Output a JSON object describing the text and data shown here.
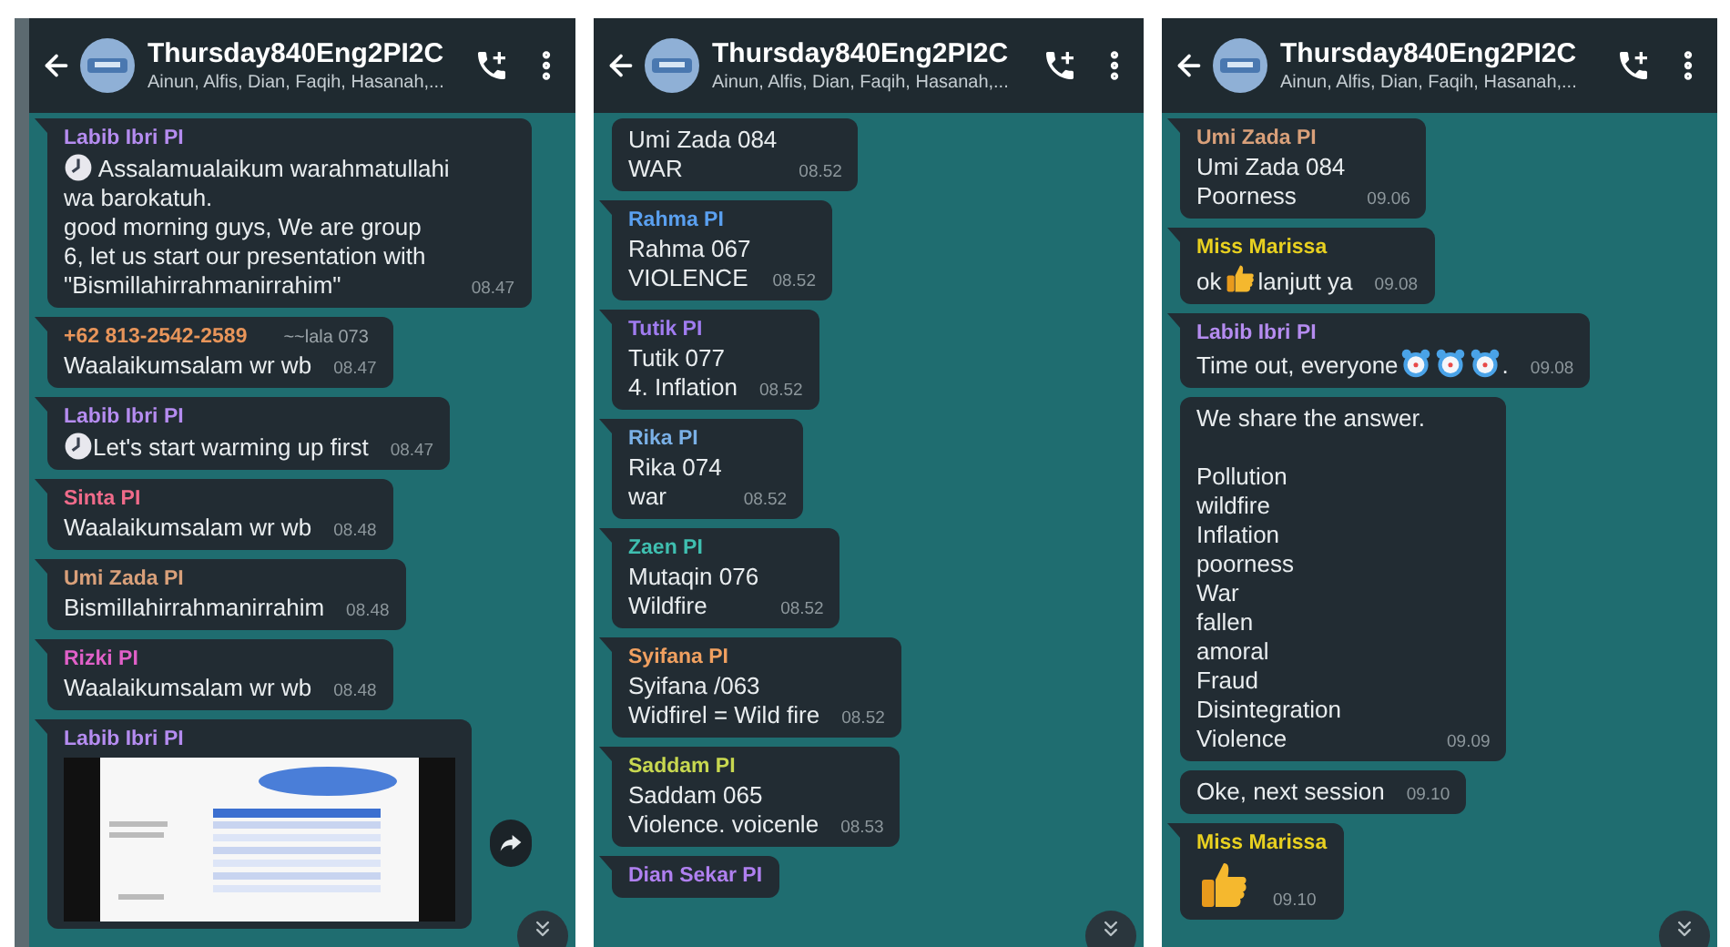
{
  "panels": [
    {
      "header": {
        "title": "Thursday840Eng2PI2C",
        "subtitle": "Ainun, Alfis, Dian, Faqih, Hasanah,..."
      },
      "messages": [
        {
          "sender": "Labib Ibri PI",
          "color": "#b58cf0",
          "segments": [
            {
              "kind": "clock"
            },
            {
              "kind": "text",
              "text": " Assalamualaikum warahmatullahi\nwa barokatuh.\ngood morning guys, We are group\n6, let us start our presentation with\n\"Bismillahirrahmanirrahim\""
            }
          ],
          "time": "08.47"
        },
        {
          "sender": "+62 813-2542-2589",
          "color": "#e8955a",
          "pushname": "~~lala 073",
          "segments": [
            {
              "kind": "text",
              "text": "Waalaikumsalam wr wb"
            }
          ],
          "time": "08.47"
        },
        {
          "sender": "Labib Ibri PI",
          "color": "#b58cf0",
          "segments": [
            {
              "kind": "clock"
            },
            {
              "kind": "text",
              "text": "Let's start warming up first"
            }
          ],
          "time": "08.47"
        },
        {
          "sender": "Sinta PI",
          "color": "#f06b8a",
          "segments": [
            {
              "kind": "text",
              "text": "Waalaikumsalam wr wb"
            }
          ],
          "time": "08.48"
        },
        {
          "sender": "Umi Zada PI",
          "color": "#d9a07a",
          "segments": [
            {
              "kind": "text",
              "text": "Bismillahirrahmanirrahim"
            }
          ],
          "time": "08.48"
        },
        {
          "sender": "Rizki PI",
          "color": "#e060c8",
          "segments": [
            {
              "kind": "text",
              "text": "Waalaikumsalam wr wb"
            }
          ],
          "time": "08.48"
        },
        {
          "sender": "Labib Ibri PI",
          "color": "#b58cf0",
          "kind": "picture"
        }
      ]
    },
    {
      "header": {
        "title": "Thursday840Eng2PI2C",
        "subtitle": "Ainun, Alfis, Dian, Faqih, Hasanah,..."
      },
      "messages": [
        {
          "segments": [
            {
              "kind": "text",
              "text": "Umi Zada 084\nWAR"
            }
          ],
          "time": "08.52"
        },
        {
          "sender": "Rahma PI",
          "color": "#5aa0f0",
          "segments": [
            {
              "kind": "text",
              "text": "Rahma 067\nVIOLENCE"
            }
          ],
          "time": "08.52"
        },
        {
          "sender": "Tutik PI",
          "color": "#a07cf0",
          "segments": [
            {
              "kind": "text",
              "text": "Tutik 077\n4. Inflation"
            }
          ],
          "time": "08.52"
        },
        {
          "sender": "Rika PI",
          "color": "#7ab0e6",
          "segments": [
            {
              "kind": "text",
              "text": "Rika 074\nwar"
            }
          ],
          "time": "08.52"
        },
        {
          "sender": "Zaen PI",
          "color": "#3fbfb0",
          "segments": [
            {
              "kind": "text",
              "text": "Mutaqin 076\nWildfire"
            }
          ],
          "time": "08.52"
        },
        {
          "sender": "Syifana PI",
          "color": "#f0a060",
          "segments": [
            {
              "kind": "text",
              "text": "Syifana /063\nWidfirel = Wild fire"
            }
          ],
          "time": "08.52"
        },
        {
          "sender": "Saddam PI",
          "color": "#c8d850",
          "segments": [
            {
              "kind": "text",
              "text": "Saddam 065\nViolence. voicenle"
            }
          ],
          "time": "08.53"
        },
        {
          "sender": "Dian Sekar PI",
          "color": "#b080f0"
        }
      ]
    },
    {
      "header": {
        "title": "Thursday840Eng2PI2C",
        "subtitle": "Ainun, Alfis, Dian, Faqih, Hasanah,..."
      },
      "messages": [
        {
          "sender": "Umi Zada PI",
          "color": "#d9a07a",
          "segments": [
            {
              "kind": "text",
              "text": "Umi Zada 084\nPoorness"
            }
          ],
          "time": "09.06"
        },
        {
          "sender": "Miss Marissa",
          "color": "#e8d020",
          "segments": [
            {
              "kind": "text",
              "text": "ok"
            },
            {
              "kind": "thumb"
            },
            {
              "kind": "text",
              "text": "lanjutt ya"
            }
          ],
          "time": "09.08"
        },
        {
          "sender": "Labib Ibri PI",
          "color": "#b58cf0",
          "segments": [
            {
              "kind": "text",
              "text": "Time out, everyone"
            },
            {
              "kind": "alarm"
            },
            {
              "kind": "alarm"
            },
            {
              "kind": "alarm"
            },
            {
              "kind": "text",
              "text": "."
            }
          ],
          "time": "09.08"
        },
        {
          "segments": [
            {
              "kind": "text",
              "text": "We share the answer.\n\nPollution\nwildfire\nInflation\npoorness\nWar\nfallen\namoral\nFraud\nDisintegration\nViolence"
            }
          ],
          "time": "09.09"
        },
        {
          "segments": [
            {
              "kind": "text",
              "text": "Oke, next session"
            }
          ],
          "time": "09.10"
        },
        {
          "sender": "Miss Marissa",
          "color": "#e8d020",
          "segments": [
            {
              "kind": "big-thumb"
            }
          ],
          "time": "09.10"
        }
      ]
    }
  ]
}
